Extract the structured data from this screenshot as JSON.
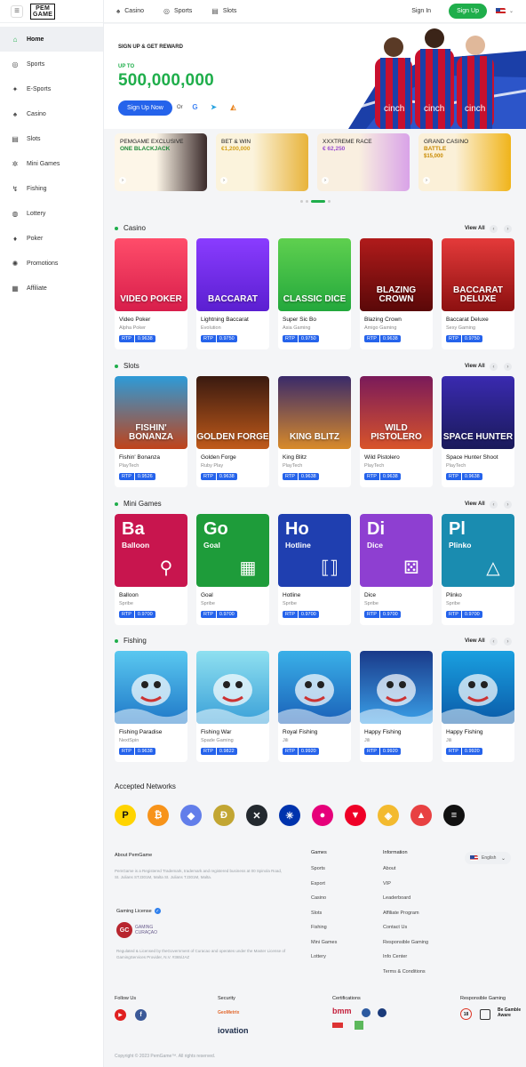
{
  "logo": {
    "line1": "PEM",
    "line2": "GAME"
  },
  "sidebar": {
    "items": [
      {
        "label": "Home",
        "icon": "home-icon",
        "glyph": "⌂"
      },
      {
        "label": "Sports",
        "icon": "ball-icon",
        "glyph": "◎"
      },
      {
        "label": "E-Sports",
        "icon": "gamepad-icon",
        "glyph": "✦"
      },
      {
        "label": "Casino",
        "icon": "cards-icon",
        "glyph": "♠"
      },
      {
        "label": "Slots",
        "icon": "slot-icon",
        "glyph": "▤"
      },
      {
        "label": "Mini Games",
        "icon": "gear-icon",
        "glyph": "✲"
      },
      {
        "label": "Fishing",
        "icon": "fish-icon",
        "glyph": "↯"
      },
      {
        "label": "Lottery",
        "icon": "lottery-icon",
        "glyph": "◍"
      },
      {
        "label": "Poker",
        "icon": "poker-icon",
        "glyph": "♦"
      },
      {
        "label": "Promotions",
        "icon": "promo-icon",
        "glyph": "✺"
      },
      {
        "label": "Affiliate",
        "icon": "affiliate-icon",
        "glyph": "▦"
      }
    ]
  },
  "topbar": {
    "casino": "Casino",
    "sports": "Sports",
    "slots": "Slots",
    "signin": "Sign In",
    "signup": "Sign Up"
  },
  "hero": {
    "eyebrow": "SIGN UP & GET REWARD",
    "upto": "UP TO",
    "amount": "500,000,000",
    "button": "Sign Up Now",
    "or": "Or",
    "shirt_text": "cinch"
  },
  "promos": [
    {
      "t1": "PEMGAME EXCLUSIVE",
      "t2": "ONE BLACKJACK",
      "color": "#1f8a3a"
    },
    {
      "t1": "BET & WIN",
      "t2": "€1,200,000",
      "color": "#d4a017"
    },
    {
      "t1": "XXXTREME RACE",
      "t2": "€ 62,250",
      "color": "#9b4fd0"
    },
    {
      "t1": "GRAND CASINO",
      "t2": "BATTLE",
      "t3": "$15,000",
      "color": "#c98a00"
    }
  ],
  "sections": {
    "casino": {
      "title": "Casino",
      "viewall": "View All",
      "games": [
        {
          "cap": "VIDEO POKER",
          "name": "Video Poker",
          "prov": "Alpha Poker",
          "rtp": "0.9638"
        },
        {
          "cap": "BACCARAT",
          "name": "Lightning Baccarat",
          "prov": "Evolution",
          "rtp": "0.9750"
        },
        {
          "cap": "CLASSIC DICE",
          "name": "Super Sic Bo",
          "prov": "Asia Gaming",
          "rtp": "0.9750"
        },
        {
          "cap": "BLAZING CROWN",
          "name": "Blazing Crown",
          "prov": "Amigo Gaming",
          "rtp": "0.9638"
        },
        {
          "cap": "BACCARAT DELUXE",
          "name": "Baccarat Deluxe",
          "prov": "Sexy Gaming",
          "rtp": "0.9750"
        }
      ]
    },
    "slots": {
      "title": "Slots",
      "viewall": "View All",
      "games": [
        {
          "cap": "FISHIN' BONANZA",
          "name": "Fishin' Bonanza",
          "prov": "PlayTech",
          "rtp": "0.9526"
        },
        {
          "cap": "GOLDEN FORGE",
          "name": "Golden Forge",
          "prov": "Ruby Play",
          "rtp": "0.9638"
        },
        {
          "cap": "KING BLITZ",
          "name": "King Blitz",
          "prov": "PlayTech",
          "rtp": "0.9638"
        },
        {
          "cap": "WILD PISTOLERO",
          "name": "Wild Pistolero",
          "prov": "PlayTech",
          "rtp": "0.9638"
        },
        {
          "cap": "SPACE HUNTER",
          "name": "Space Hunter Shoot",
          "prov": "PlayTech",
          "rtp": "0.9638"
        }
      ]
    },
    "mini": {
      "title": "Mini Games",
      "viewall": "View All",
      "games": [
        {
          "big": "Ba",
          "small": "Balloon",
          "name": "Balloon",
          "prov": "Spribe",
          "rtp": "0.9700"
        },
        {
          "big": "Go",
          "small": "Goal",
          "name": "Goal",
          "prov": "Spribe",
          "rtp": "0.9700"
        },
        {
          "big": "Ho",
          "small": "Hotline",
          "name": "Hotline",
          "prov": "Spribe",
          "rtp": "0.9700"
        },
        {
          "big": "Di",
          "small": "Dice",
          "name": "Dice",
          "prov": "Spribe",
          "rtp": "0.9700"
        },
        {
          "big": "Pl",
          "small": "Plinko",
          "name": "Plinko",
          "prov": "Spribe",
          "rtp": "0.9700"
        }
      ]
    },
    "fishing": {
      "title": "Fishing",
      "viewall": "View All",
      "games": [
        {
          "name": "Fishing Paradise",
          "prov": "NextSpin",
          "rtp": "0.9638"
        },
        {
          "name": "Fishing War",
          "prov": "Spade Gaming",
          "rtp": "0.9822"
        },
        {
          "name": "Royal Fishing",
          "prov": "Jili",
          "rtp": "0.9920"
        },
        {
          "name": "Happy Fishing",
          "prov": "Jili",
          "rtp": "0.9920"
        },
        {
          "name": "Happy Fishing",
          "prov": "Jili",
          "rtp": "0.9920"
        }
      ]
    }
  },
  "rtp_label": "RTP",
  "networks": {
    "title": "Accepted Networks",
    "coins": [
      {
        "name": "tron-pay-icon",
        "glyph": "P",
        "color": "#111"
      },
      {
        "name": "bitcoin-icon",
        "glyph": "₿",
        "color": "#f7931a"
      },
      {
        "name": "ethereum-icon",
        "glyph": "◆",
        "color": "#627eea"
      },
      {
        "name": "dogecoin-icon",
        "glyph": "Ð",
        "color": "#c2a633"
      },
      {
        "name": "xrp-icon",
        "glyph": "✕",
        "color": "#23292f"
      },
      {
        "name": "cardano-icon",
        "glyph": "✳",
        "color": "#0033ad"
      },
      {
        "name": "polkadot-icon",
        "glyph": "●",
        "color": "#e6007a"
      },
      {
        "name": "tron-icon",
        "glyph": "▼",
        "color": "#ef0027"
      },
      {
        "name": "bnb-icon",
        "glyph": "◈",
        "color": "#f3ba2f"
      },
      {
        "name": "avalanche-icon",
        "glyph": "▲",
        "color": "#e84142"
      },
      {
        "name": "solana-icon",
        "glyph": "≡",
        "color": "#111"
      }
    ]
  },
  "footer": {
    "about_title": "About PemGame",
    "about_text": "PemGame is a Registered Trademark, trademark and registered business at 00 Spinola Road, St. Julians STJ301M, Malta St. Julians TJ301M, Malta.",
    "license_title": "Gaming License",
    "license_logo": "GAMING CURAÇAO",
    "license_text": "Regulated & Licensed by theGovernment of Curacao and operates under the Master License of GamingServices Provider, N.V. #365/JAZ",
    "games_title": "Games",
    "games_links": [
      "Sports",
      "Esport",
      "Casino",
      "Slots",
      "Fishing",
      "Mini Games",
      "Lottery"
    ],
    "info_title": "Information",
    "info_links": [
      "About",
      "VIP",
      "Leaderboard",
      "Affiliate Program",
      "Contact Us",
      "Responsible Gaming",
      "Info Center",
      "Terms & Conditions"
    ],
    "lang": "English",
    "follow": "Follow Us",
    "security": "Security",
    "security_logo1": "GeoMetrix",
    "security_logo2": "iovation",
    "certs": "Certifications",
    "cert_logo": "bmm",
    "responsible": "Responsible Gaming",
    "age": "18",
    "gamble_aware": "Be Gamble Aware",
    "copyright": "Copyright © 2023 PemGame™. All rights reserved."
  }
}
